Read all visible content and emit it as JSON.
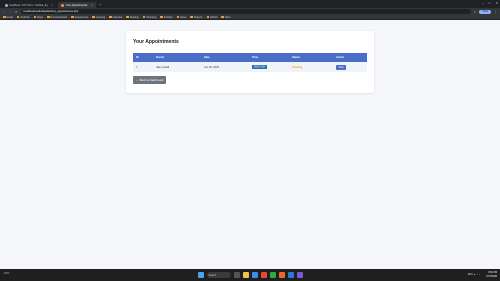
{
  "browser": {
    "tabs": [
      {
        "label": "localhost / 127.0.0.1 / medica_dg",
        "active": false
      },
      {
        "label": "Your Appointments",
        "active": true
      }
    ],
    "url": "localhost/medical/patient/my_appointments.php",
    "profile": "Work",
    "bookmarks": [
      "Gmail",
      "YouTube",
      "Maps",
      "Doc Dashboard",
      "Assignments",
      "Learning",
      "Calendar",
      "Reading",
      "Shopping",
      "Portfolio",
      "Notes",
      "Projects",
      "GitHub",
      "Drive"
    ]
  },
  "page": {
    "title": "Your Appointments",
    "table": {
      "headers": [
        "ID",
        "Doctor",
        "Date",
        "Time",
        "Status",
        "Action"
      ],
      "rows": [
        {
          "id": "7",
          "doctor": "rakin pukall",
          "date": "Jun 18, 2025",
          "time": "09:00 AM",
          "status": "Pending",
          "action": "View"
        }
      ]
    },
    "back_button": "← Back to Dashboard"
  },
  "taskbar": {
    "search_placeholder": "Search",
    "weather": "31°C",
    "time": "3:51 PM",
    "date": "6/17/2025",
    "language": "ENG"
  },
  "colors": {
    "header_blue": "#4a6ec8",
    "status_pending": "#f0a500",
    "back_button": "#6c757d"
  }
}
